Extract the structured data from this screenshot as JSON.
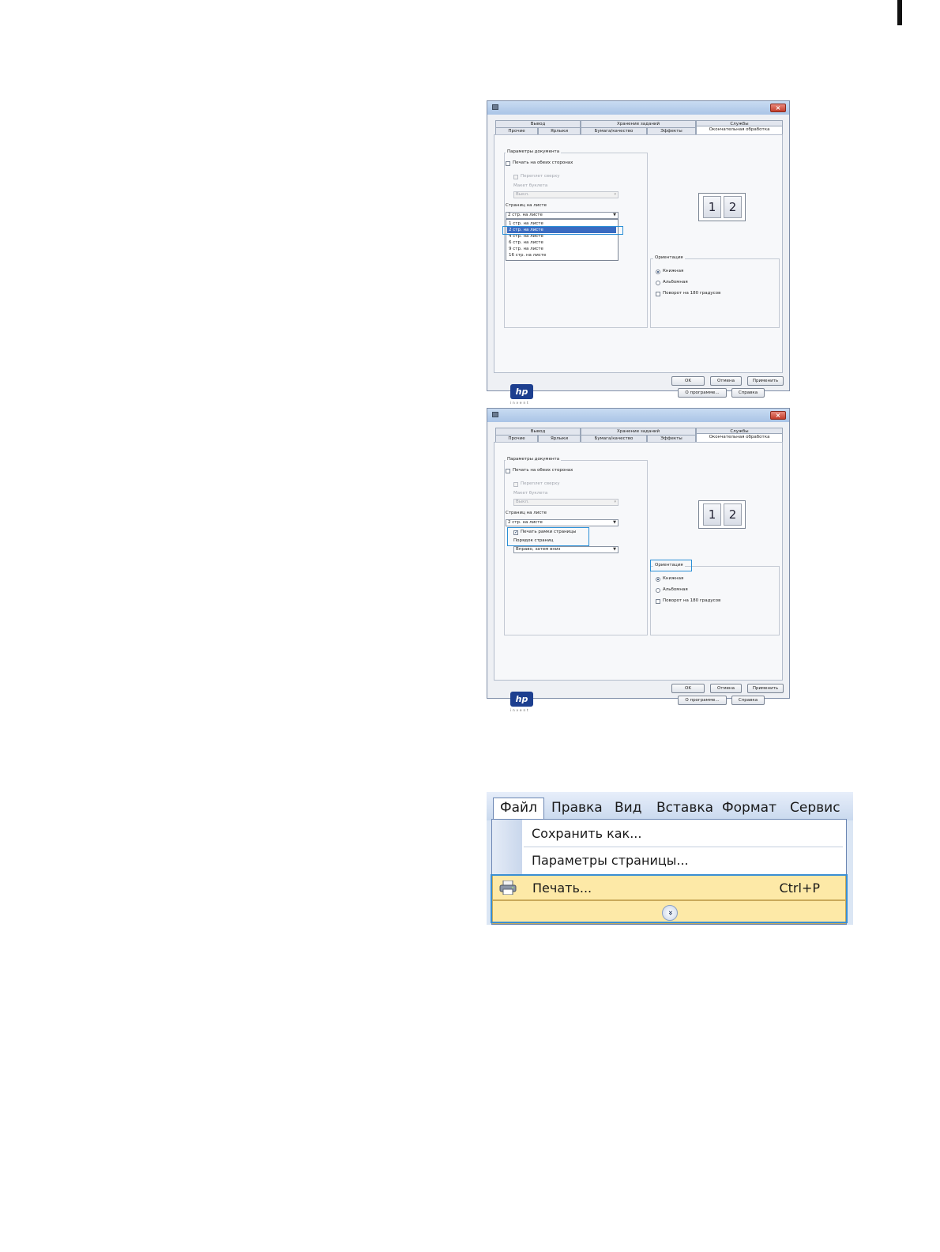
{
  "tabs_row1": [
    "Вывод",
    "Хранение заданий",
    "Службы"
  ],
  "tabs_row2": [
    "Прочие",
    "Ярлыки",
    "Бумага/качество",
    "Эффекты",
    "Окончательная обработка"
  ],
  "doc_params": {
    "group_title": "Параметры документа",
    "duplex_label": "Печать на обеих сторонах",
    "flip_up_label": "Переплет сверху",
    "booklet_label": "Макет буклета",
    "booklet_value": "Выкл.",
    "pages_per_sheet_label": "Страниц на листе",
    "pages_per_sheet_value": "2 стр. на листе"
  },
  "pages_options": [
    "1 стр. на листе",
    "2 стр. на листе",
    "4 стр. на листе",
    "6 стр. на листе",
    "9 стр. на листе",
    "16 стр. на листе"
  ],
  "page_borders_label": "Печать рамки страницы",
  "page_order_label": "Порядок страниц",
  "page_order_value": "Вправо, затем вниз",
  "preview_pages": [
    "1",
    "2"
  ],
  "orientation": {
    "group_title": "Ориентация",
    "portrait": "Книжная",
    "landscape": "Альбомная",
    "rotate": "Поворот на 180 градусов"
  },
  "buttons": {
    "about": "О программе...",
    "help": "Справка",
    "ok": "OK",
    "cancel": "Отмена",
    "apply": "Применить"
  },
  "logo": {
    "text": "hp",
    "sub": "invent"
  },
  "word_menu": {
    "bar": [
      "Файл",
      "Правка",
      "Вид",
      "Вставка",
      "Формат",
      "Сервис"
    ],
    "save_as": "Сохранить как...",
    "page_setup": "Параметры страницы...",
    "print": "Печать...",
    "print_shortcut": "Ctrl+P",
    "expand_glyph": "»"
  }
}
